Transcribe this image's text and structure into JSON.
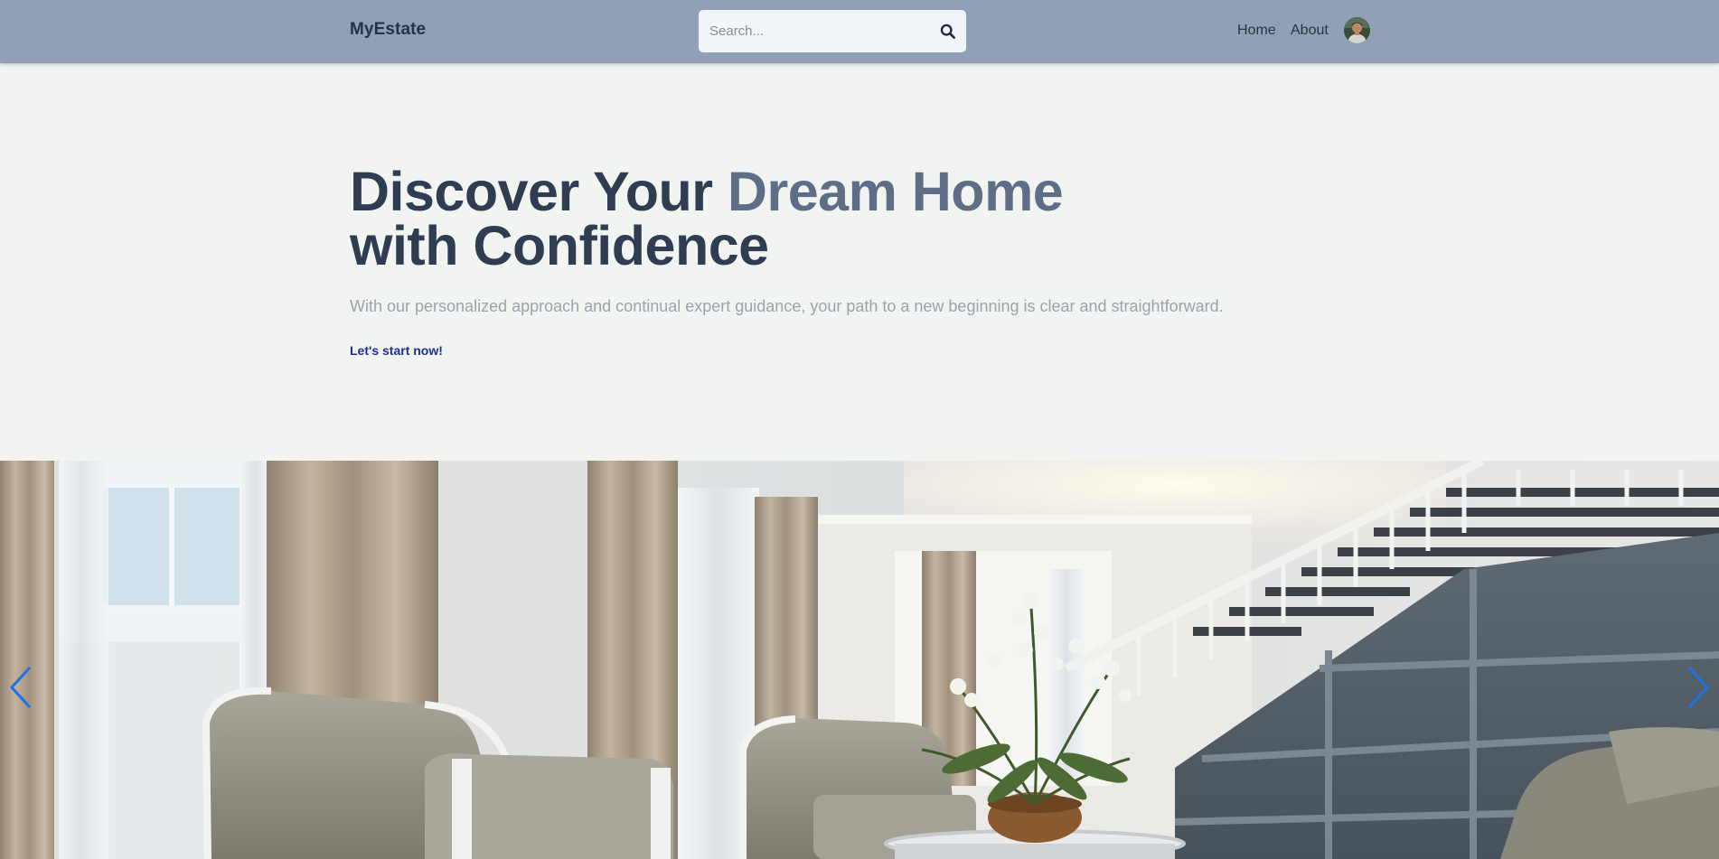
{
  "navbar": {
    "brand": "MyEstate",
    "search": {
      "placeholder": "Search...",
      "value": "",
      "icon": "search-icon"
    },
    "links": [
      {
        "label": "Home"
      },
      {
        "label": "About"
      }
    ],
    "avatar_icon": "user-avatar"
  },
  "hero": {
    "title_part1": "Discover Your ",
    "title_accent": "Dream Home",
    "title_part2": "with Confidence",
    "subtitle": "With our personalized approach and continual expert guidance, your path to a new beginning is clear and straightforward.",
    "cta_label": "Let's start now!"
  },
  "carousel": {
    "prev_icon": "chevron-left-icon",
    "next_icon": "chevron-right-icon",
    "arrow_color": "#1a73e8"
  },
  "colors": {
    "navbar_bg": "#8fa0b7",
    "hero_bg": "#f1f4f1",
    "title": "#2f3d52",
    "title_accent": "#5d6e86",
    "cta": "#1e2f8f"
  }
}
